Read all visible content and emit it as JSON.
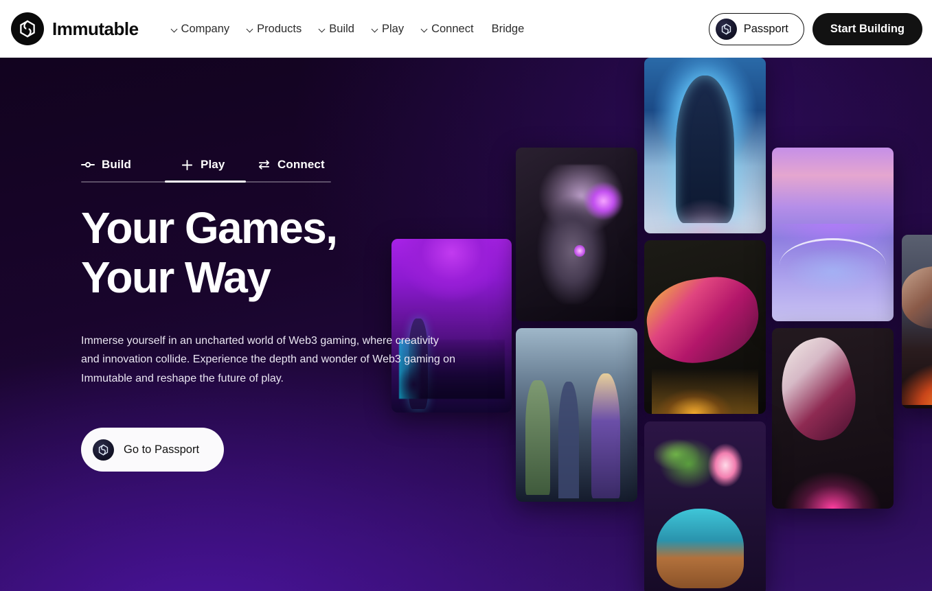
{
  "header": {
    "brand_name": "Immutable",
    "logo_icon": "immutable-logo-icon",
    "nav_items": [
      {
        "label": "Company",
        "has_chevron": true
      },
      {
        "label": "Products",
        "has_chevron": true
      },
      {
        "label": "Build",
        "has_chevron": true
      },
      {
        "label": "Play",
        "has_chevron": true
      },
      {
        "label": "Connect",
        "has_chevron": true
      },
      {
        "label": "Bridge",
        "has_chevron": false
      }
    ],
    "passport_button": {
      "label": "Passport",
      "icon": "passport-coin-icon"
    },
    "start_button": {
      "label": "Start Building"
    }
  },
  "hero": {
    "tabs": [
      {
        "label": "Build",
        "icon": "node-connector-icon",
        "active": false
      },
      {
        "label": "Play",
        "icon": "plus-icon",
        "active": true
      },
      {
        "label": "Connect",
        "icon": "swap-arrows-icon",
        "active": false
      }
    ],
    "title": "Your Games,\nYour Way",
    "subtitle": "Immerse yourself in an uncharted world of Web3 gaming, where creativity and innovation collide. Experience the depth and wonder of Web3 gaming on Immutable and reshape the future of play.",
    "cta": {
      "label": "Go to Passport",
      "icon": "passport-coin-icon"
    }
  },
  "gallery": {
    "items": [
      {
        "name": "neon-purple-landscape-art",
        "alt": "Purple neon sci-fi landscape with a lone character"
      },
      {
        "name": "stone-beast-art",
        "alt": "Armored stone beast with glowing violet eye"
      },
      {
        "name": "hero-party-art",
        "alt": "Party of fantasy heroes standing together"
      },
      {
        "name": "ice-mage-art",
        "alt": "Hooded mage glowing with blue ice energy"
      },
      {
        "name": "gold-pink-worm-art",
        "alt": "Pink and gold armored worm with open jaws"
      },
      {
        "name": "pastel-arena-art",
        "alt": "Pastel purple arena with cute creatures"
      },
      {
        "name": "white-fox-spirit-art",
        "alt": "White and crimson fox spirit on pink glow"
      },
      {
        "name": "mushroom-creature-art",
        "alt": "Blue mushroom creature with flowers"
      },
      {
        "name": "fire-warrior-art",
        "alt": "Warrior silhouette amid orange fire"
      }
    ]
  },
  "colors": {
    "header_bg": "#ffffff",
    "hero_bg_top": "#12031f",
    "hero_bg_bottom": "#35116b",
    "accent_white": "#ffffff",
    "button_dark": "#121212",
    "text_dark": "#2c2c2c"
  }
}
